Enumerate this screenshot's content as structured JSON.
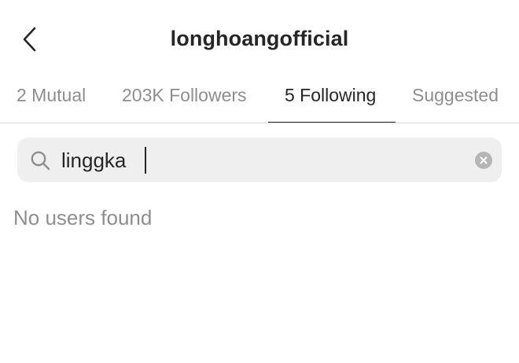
{
  "header": {
    "title": "longhoangofficial",
    "back_icon": "chevron-left-icon"
  },
  "tabs": [
    {
      "label": "2 Mutual",
      "active": false
    },
    {
      "label": "203K Followers",
      "active": false
    },
    {
      "label": "5 Following",
      "active": true
    },
    {
      "label": "Suggested",
      "active": false
    }
  ],
  "search": {
    "value": "linggka",
    "icon": "search-icon",
    "clear_icon": "clear-icon"
  },
  "results": {
    "empty_message": "No users found"
  },
  "colors": {
    "text_primary": "#262626",
    "text_secondary": "#8e8e8e",
    "search_background": "#efefef",
    "divider": "#dbdbdb"
  }
}
